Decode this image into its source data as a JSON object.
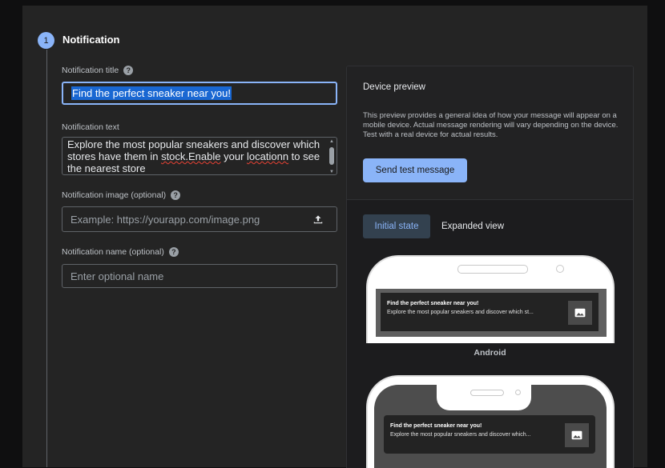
{
  "step": {
    "number": "1",
    "title": "Notification"
  },
  "fields": {
    "title_label": "Notification title",
    "title_value": "Find the perfect sneaker near you!",
    "text_label": "Notification text",
    "text_part1": "Explore the most popular sneakers and discover which stores have them in ",
    "text_misspelled1": "stock.Enable",
    "text_part2": " your ",
    "text_misspelled2": "locationn",
    "text_part3": " to see the nearest store",
    "image_label": "Notification image (optional)",
    "image_placeholder": "Example: https://yourapp.com/image.png",
    "name_label": "Notification name (optional)",
    "name_placeholder": "Enter optional name",
    "help_glyph": "?"
  },
  "preview": {
    "title": "Device preview",
    "description": "This preview provides a general idea of how your message will appear on a mobile device. Actual message rendering will vary depending on the device. Test with a real device for actual results.",
    "send_button": "Send test message",
    "tabs": [
      {
        "label": "Initial state",
        "active": true
      },
      {
        "label": "Expanded view",
        "active": false
      }
    ],
    "notification_title": "Find the perfect sneaker near you!",
    "notification_body_1": "Explore the most popular sneakers and discover which st...",
    "notification_body_2": "Explore the most popular sneakers and discover which...",
    "android_label": "Android"
  },
  "icons": {
    "upload": "upload-icon",
    "image": "image-icon",
    "help": "help-icon"
  },
  "colors": {
    "accent": "#8ab4f8",
    "selection": "#1967d2",
    "panel": "#242424",
    "spellcheck": "#ea4335"
  }
}
